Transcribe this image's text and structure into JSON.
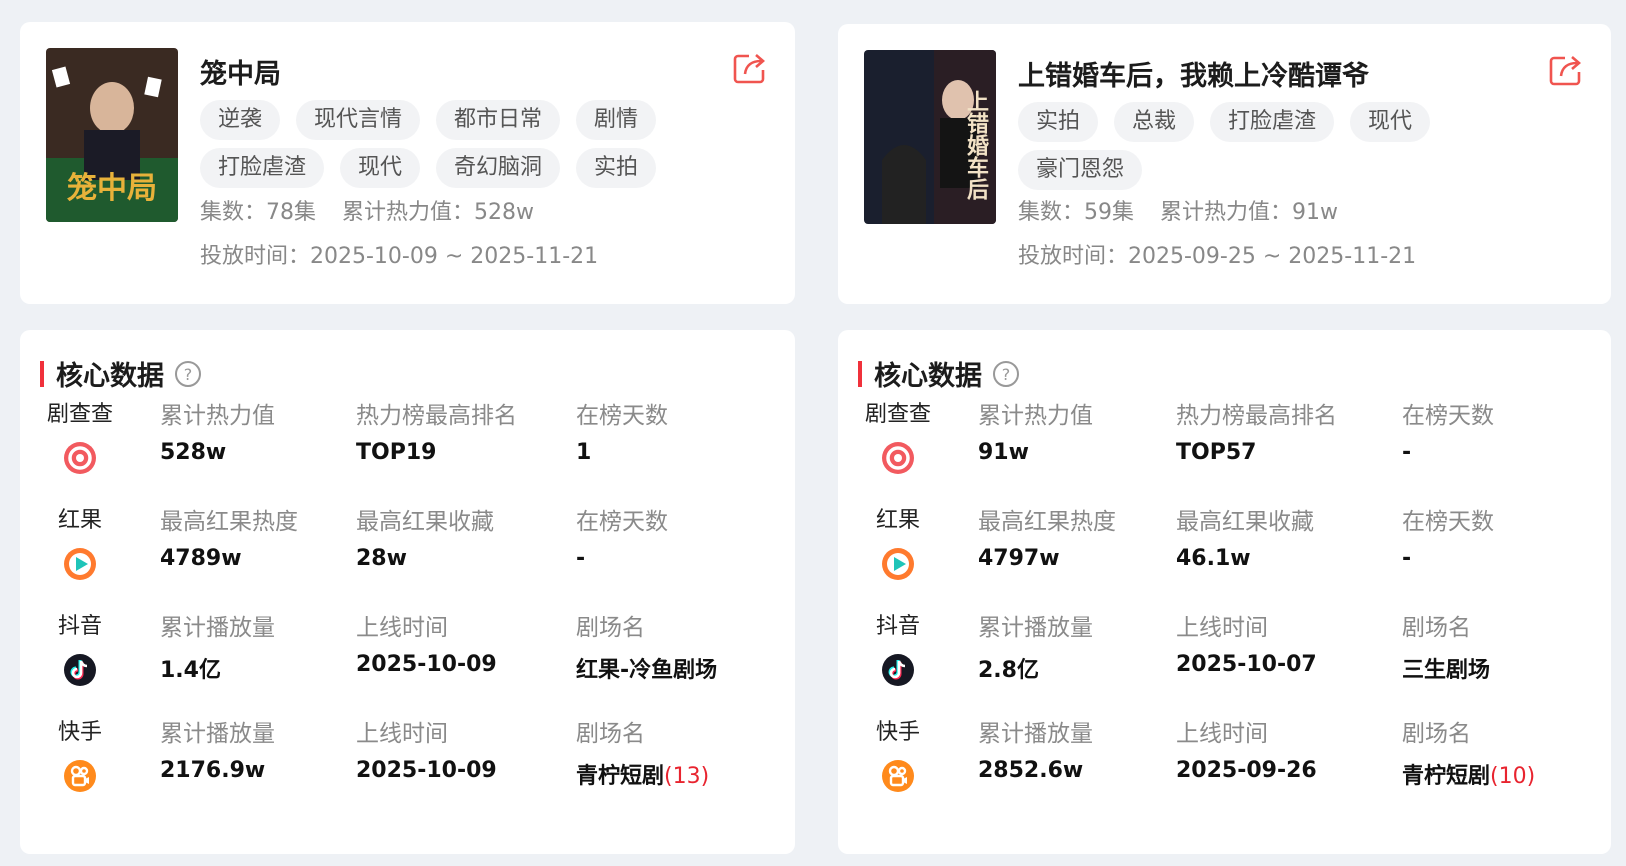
{
  "dramas": [
    {
      "title": "笼中局",
      "cover_text": "笼中局",
      "tags": [
        "逆袭",
        "现代言情",
        "都市日常",
        "剧情",
        "打脸虐渣",
        "现代",
        "奇幻脑洞",
        "实拍"
      ],
      "episodes": "集数：78集",
      "total_heat": "累计热力值：528w",
      "air_time": "投放时间：2025-10-09 ~ 2025-11-21",
      "core": {
        "title": "核心数据",
        "rows": [
          {
            "platform": "剧查查",
            "icon": "juchacha-icon",
            "stats": [
              {
                "label": "累计热力值",
                "value": "528w"
              },
              {
                "label": "热力榜最高排名",
                "value": "TOP19"
              },
              {
                "label": "在榜天数",
                "value": "1"
              }
            ]
          },
          {
            "platform": "红果",
            "icon": "hongguo-icon",
            "stats": [
              {
                "label": "最高红果热度",
                "value": "4789w"
              },
              {
                "label": "最高红果收藏",
                "value": "28w"
              },
              {
                "label": "在榜天数",
                "value": "-"
              }
            ]
          },
          {
            "platform": "抖音",
            "icon": "douyin-icon",
            "stats": [
              {
                "label": "累计播放量",
                "value": "1.4亿"
              },
              {
                "label": "上线时间",
                "value": "2025-10-09"
              },
              {
                "label": "剧场名",
                "value": "红果-冷鱼剧场"
              }
            ]
          },
          {
            "platform": "快手",
            "icon": "kuaishou-icon",
            "stats": [
              {
                "label": "累计播放量",
                "value": "2176.9w"
              },
              {
                "label": "上线时间",
                "value": "2025-10-09"
              },
              {
                "label": "剧场名",
                "value": "青柠短剧",
                "suffix": "(13)"
              }
            ]
          }
        ]
      }
    },
    {
      "title": "上错婚车后，我赖上冷酷谭爷",
      "cover_text": "上错婚车后",
      "tags": [
        "实拍",
        "总裁",
        "打脸虐渣",
        "现代",
        "豪门恩怨"
      ],
      "episodes": "集数：59集",
      "total_heat": "累计热力值：91w",
      "air_time": "投放时间：2025-09-25 ~ 2025-11-21",
      "core": {
        "title": "核心数据",
        "rows": [
          {
            "platform": "剧查查",
            "icon": "juchacha-icon",
            "stats": [
              {
                "label": "累计热力值",
                "value": "91w"
              },
              {
                "label": "热力榜最高排名",
                "value": "TOP57"
              },
              {
                "label": "在榜天数",
                "value": "-"
              }
            ]
          },
          {
            "platform": "红果",
            "icon": "hongguo-icon",
            "stats": [
              {
                "label": "最高红果热度",
                "value": "4797w"
              },
              {
                "label": "最高红果收藏",
                "value": "46.1w"
              },
              {
                "label": "在榜天数",
                "value": "-"
              }
            ]
          },
          {
            "platform": "抖音",
            "icon": "douyin-icon",
            "stats": [
              {
                "label": "累计播放量",
                "value": "2.8亿"
              },
              {
                "label": "上线时间",
                "value": "2025-10-07"
              },
              {
                "label": "剧场名",
                "value": "三生剧场"
              }
            ]
          },
          {
            "platform": "快手",
            "icon": "kuaishou-icon",
            "stats": [
              {
                "label": "累计播放量",
                "value": "2852.6w"
              },
              {
                "label": "上线时间",
                "value": "2025-09-26"
              },
              {
                "label": "剧场名",
                "value": "青柠短剧",
                "suffix": "(10)"
              }
            ]
          }
        ]
      }
    }
  ],
  "colors": {
    "accent": "#f0313b",
    "share": "#f0544f",
    "background": "#eef1f5"
  }
}
